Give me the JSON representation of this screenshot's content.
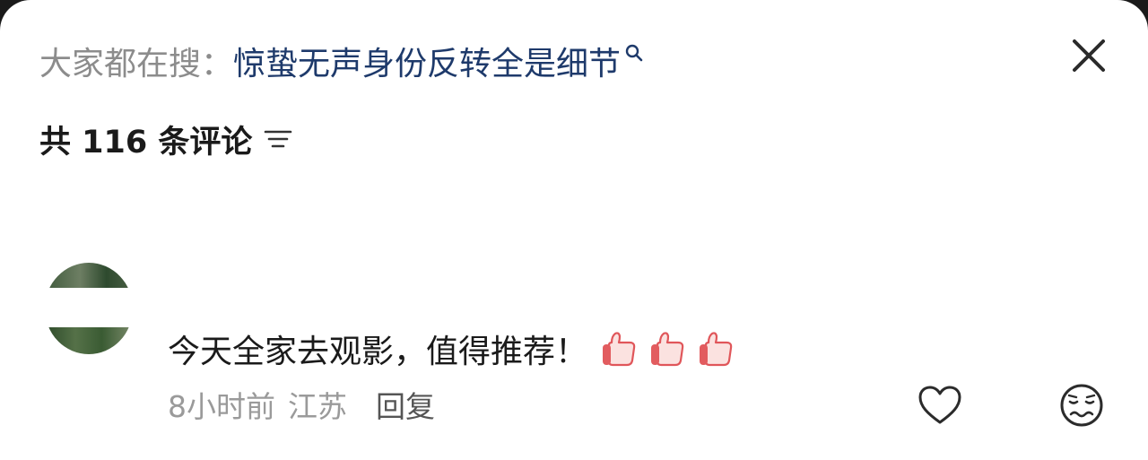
{
  "search_bar": {
    "prefix": "大家都在搜：",
    "query": "惊蛰无声身份反转全是细节",
    "search_icon": "search-icon"
  },
  "header": {
    "close_icon": "close-icon"
  },
  "comments_header": {
    "count_text": "共 116 条评论",
    "sort_icon": "sort-icon"
  },
  "comment": {
    "avatar": "user-avatar",
    "text": "今天全家去观影，值得推荐！",
    "emojis": [
      "thumbs-up-emoji",
      "thumbs-up-emoji",
      "thumbs-up-emoji"
    ],
    "time": "8小时前",
    "location": "江苏",
    "reply_label": "回复",
    "like_icon": "heart-icon",
    "dislike_icon": "dislike-face-icon"
  },
  "colors": {
    "prefix": "#8c8c8c",
    "link": "#1e3a6b",
    "text": "#1a1a1a",
    "meta": "#9a9a9a",
    "emoji": "#f28b8b"
  }
}
